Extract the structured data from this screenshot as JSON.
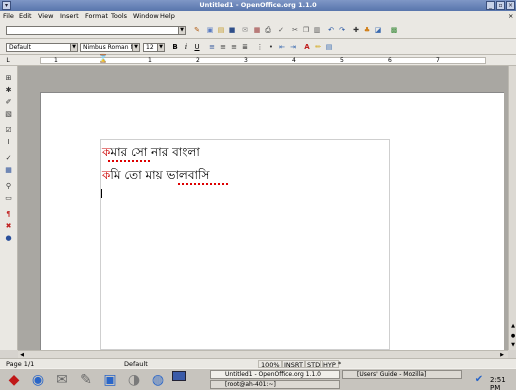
{
  "window": {
    "title": "Untitled1 - OpenOffice.org 1.1.0",
    "minimize_glyph": "_",
    "maximize_glyph": "▫",
    "close_glyph": "×"
  },
  "menubar": {
    "items": [
      "File",
      "Edit",
      "View",
      "Insert",
      "Format",
      "Tools",
      "Window",
      "Help"
    ],
    "close_glyph": "×"
  },
  "formatting": {
    "paragraph_style": "Default",
    "font_name": "Nimbus Roman N",
    "font_size": "12",
    "bold_label": "B",
    "italic_label": "i",
    "underline_label": "U"
  },
  "ruler": {
    "numbers": [
      "1",
      "1",
      "2",
      "3",
      "4",
      "5",
      "6",
      "7"
    ]
  },
  "document": {
    "line1_first": "ক",
    "line1_rest": "মার  সো   নার বাংলা",
    "line2_first": "ক",
    "line2_rest": "মি তো   মায় ভালবাসি"
  },
  "statusbar": {
    "page": "Page 1/1",
    "page_style": "Default",
    "zoom": "100%",
    "insert_mode": "INSRT",
    "selection_mode": "STD",
    "hyperlink_mode": "HYP",
    "modified": "*"
  },
  "taskbar": {
    "tasks": [
      {
        "label": "Untitled1 - OpenOffice.org 1.1.0",
        "active": true
      },
      {
        "label": "[Users' Guide - Mozilla]",
        "active": false
      },
      {
        "label": "[root@ah-401:~]",
        "active": false
      }
    ],
    "clock": "2:51 PM"
  },
  "colors": {
    "titlebar": "#5f7bb3",
    "red_letter": "#cc0000",
    "canvas": "#a9a7a2"
  }
}
